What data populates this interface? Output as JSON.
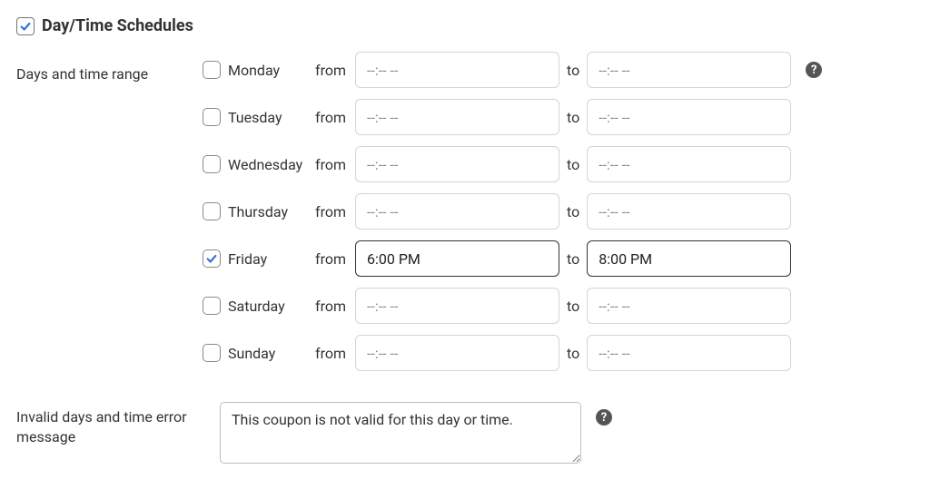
{
  "section": {
    "title": "Day/Time Schedules",
    "enabled": true
  },
  "labels": {
    "days_and_time_range": "Days and time range",
    "from": "from",
    "to": "to",
    "invalid_message_label": "Invalid days and time error message",
    "time_placeholder": "--:-- --",
    "help_glyph": "?"
  },
  "days": [
    {
      "name": "Monday",
      "checked": false,
      "from": "",
      "to": ""
    },
    {
      "name": "Tuesday",
      "checked": false,
      "from": "",
      "to": ""
    },
    {
      "name": "Wednesday",
      "checked": false,
      "from": "",
      "to": ""
    },
    {
      "name": "Thursday",
      "checked": false,
      "from": "",
      "to": ""
    },
    {
      "name": "Friday",
      "checked": true,
      "from": "6:00 PM",
      "to": "8:00 PM"
    },
    {
      "name": "Saturday",
      "checked": false,
      "from": "",
      "to": ""
    },
    {
      "name": "Sunday",
      "checked": false,
      "from": "",
      "to": ""
    }
  ],
  "invalid_message": "This coupon is not valid for this day or time."
}
